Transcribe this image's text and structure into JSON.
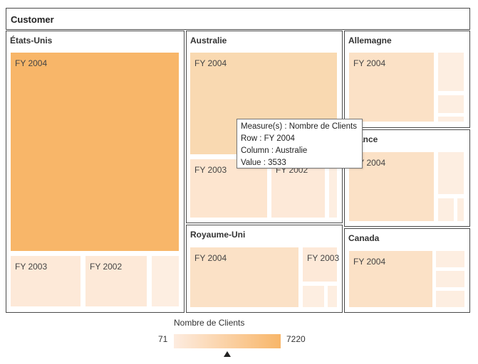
{
  "header": {
    "title": "Customer"
  },
  "groups": {
    "us": {
      "name": "États-Unis"
    },
    "au": {
      "name": "Australie"
    },
    "de": {
      "name": "Allemagne"
    },
    "fr": {
      "name": "ance"
    },
    "uk": {
      "name": "Royaume-Uni"
    },
    "ca": {
      "name": "Canada"
    }
  },
  "cells": {
    "us_2004": "FY 2004",
    "us_2003": "FY 2003",
    "us_2002": "FY 2002",
    "au_2004": "FY 2004",
    "au_2003": "FY 2003",
    "au_2002": "FY 2002",
    "de_2004": "FY 2004",
    "fr_2004": "FY 2004",
    "uk_2004": "FY 2004",
    "uk_2003": "FY 2003",
    "ca_2004": "FY 2004"
  },
  "tooltip": {
    "measure": "Measure(s) : Nombre de Clients",
    "row": "Row : FY 2004",
    "column": "Column : Australie",
    "value": "Value : 3533"
  },
  "legend": {
    "title": "Nombre de Clients",
    "min": "71",
    "max": "7220"
  },
  "colors": {
    "max": "#f8b669",
    "au_fy2004": "#f9d9b1",
    "mid": "#fbe1c6",
    "light": "#fde9d8",
    "lightest": "#fdeee1",
    "border": "#4a4a4a"
  }
}
